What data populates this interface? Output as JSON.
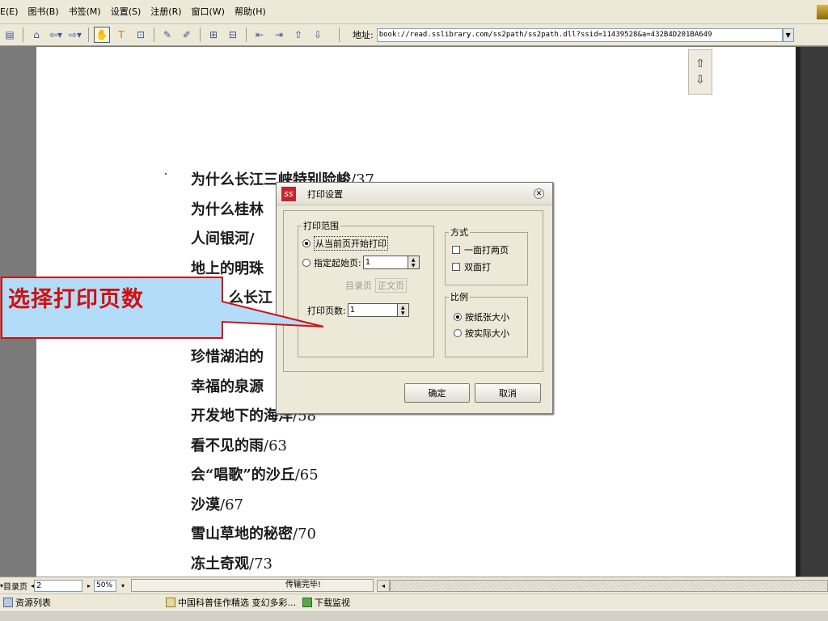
{
  "menubar": {
    "items": [
      "E(E)",
      "图书(B)",
      "书签(M)",
      "设置(S)",
      "注册(R)",
      "窗口(W)",
      "帮助(H)"
    ]
  },
  "toolbar": {
    "address_label": "地址:",
    "address_value": "book://read.sslibrary.com/ss2path/ss2path.dll?ssid=11439528&a=432B4D201BA649"
  },
  "toc": {
    "entries": [
      {
        "title": "为什么长江三峡特别险峻",
        "page": "/37"
      },
      {
        "title": "为什么桂林",
        "page": ""
      },
      {
        "title": "人间银河/",
        "page": ""
      },
      {
        "title": "地上的明珠",
        "page": ""
      },
      {
        "title": "么长江",
        "page": ""
      },
      {
        "title": "",
        "page": ""
      },
      {
        "title": "珍惜湖泊的",
        "page": ""
      },
      {
        "title": "幸福的泉源",
        "page": ""
      },
      {
        "title": "开发地下的海洋",
        "page": "/58"
      },
      {
        "title": "看不见的雨",
        "page": "/63"
      },
      {
        "title": "会“唱歌”的沙丘",
        "page": "/65"
      },
      {
        "title": "沙漠",
        "page": "/67"
      },
      {
        "title": "雪山草地的秘密",
        "page": "/70"
      },
      {
        "title": "冻土奇观",
        "page": "/73"
      }
    ]
  },
  "dialog": {
    "title": "打印设置",
    "range_group": "打印范围",
    "opt_from_current": "从当前页开始打印",
    "opt_start_page": "指定起始页:",
    "start_page_value": "1",
    "toc_page": "目录页",
    "main_page": "正文页",
    "pages_label": "打印页数:",
    "pages_value": "1",
    "mode_group": "方式",
    "mode_two_per_sheet": "一面打两页",
    "mode_duplex": "双面打",
    "scale_group": "比例",
    "scale_paper": "按纸张大小",
    "scale_actual": "按实际大小",
    "ok": "确定",
    "cancel": "取消"
  },
  "callout": {
    "text": "选择打印页数"
  },
  "statusbar": {
    "toc_label": "目录页",
    "page_value": "2",
    "zoom_value": "50%",
    "status_text": "传输完毕!"
  },
  "dock": {
    "resource_list": "资源列表",
    "book_title": "中国科普佳作精选  变幻多彩...",
    "download_monitor": "下载监视"
  }
}
